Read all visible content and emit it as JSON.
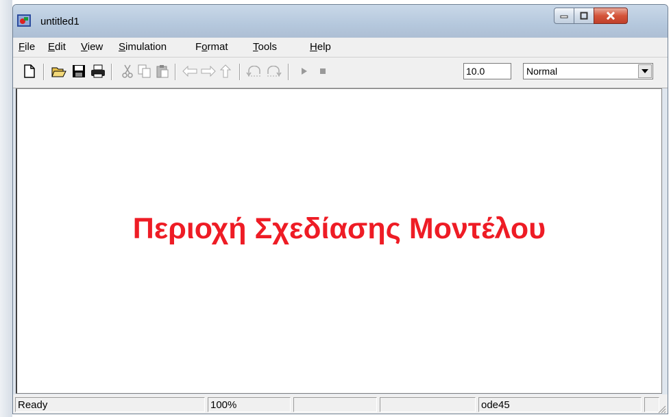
{
  "window": {
    "title": "untitled1"
  },
  "menu": [
    {
      "pre": "",
      "u": "F",
      "post": "ile"
    },
    {
      "pre": "",
      "u": "E",
      "post": "dit"
    },
    {
      "pre": "",
      "u": "V",
      "post": "iew"
    },
    {
      "pre": "",
      "u": "S",
      "post": "imulation"
    },
    {
      "pre": "F",
      "u": "o",
      "post": "rmat"
    },
    {
      "pre": "",
      "u": "T",
      "post": "ools"
    },
    {
      "pre": "",
      "u": "H",
      "post": "elp"
    }
  ],
  "toolbar": {
    "stop_time": "10.0",
    "sim_mode": "Normal",
    "icons": [
      "new-icon",
      "open-icon",
      "save-icon",
      "print-icon",
      "cut-icon",
      "copy-icon",
      "paste-icon",
      "back-icon",
      "forward-icon",
      "up-icon",
      "undo-icon",
      "redo-icon",
      "start-icon",
      "stop-icon"
    ]
  },
  "canvas": {
    "label": "Περιοχή Σχεδίασης Μοντέλου"
  },
  "status": {
    "state": "Ready",
    "zoom": "100%",
    "blank1": "",
    "blank2": "",
    "solver": "ode45",
    "blank3": ""
  },
  "colors": {
    "label": "#ee1c25"
  }
}
